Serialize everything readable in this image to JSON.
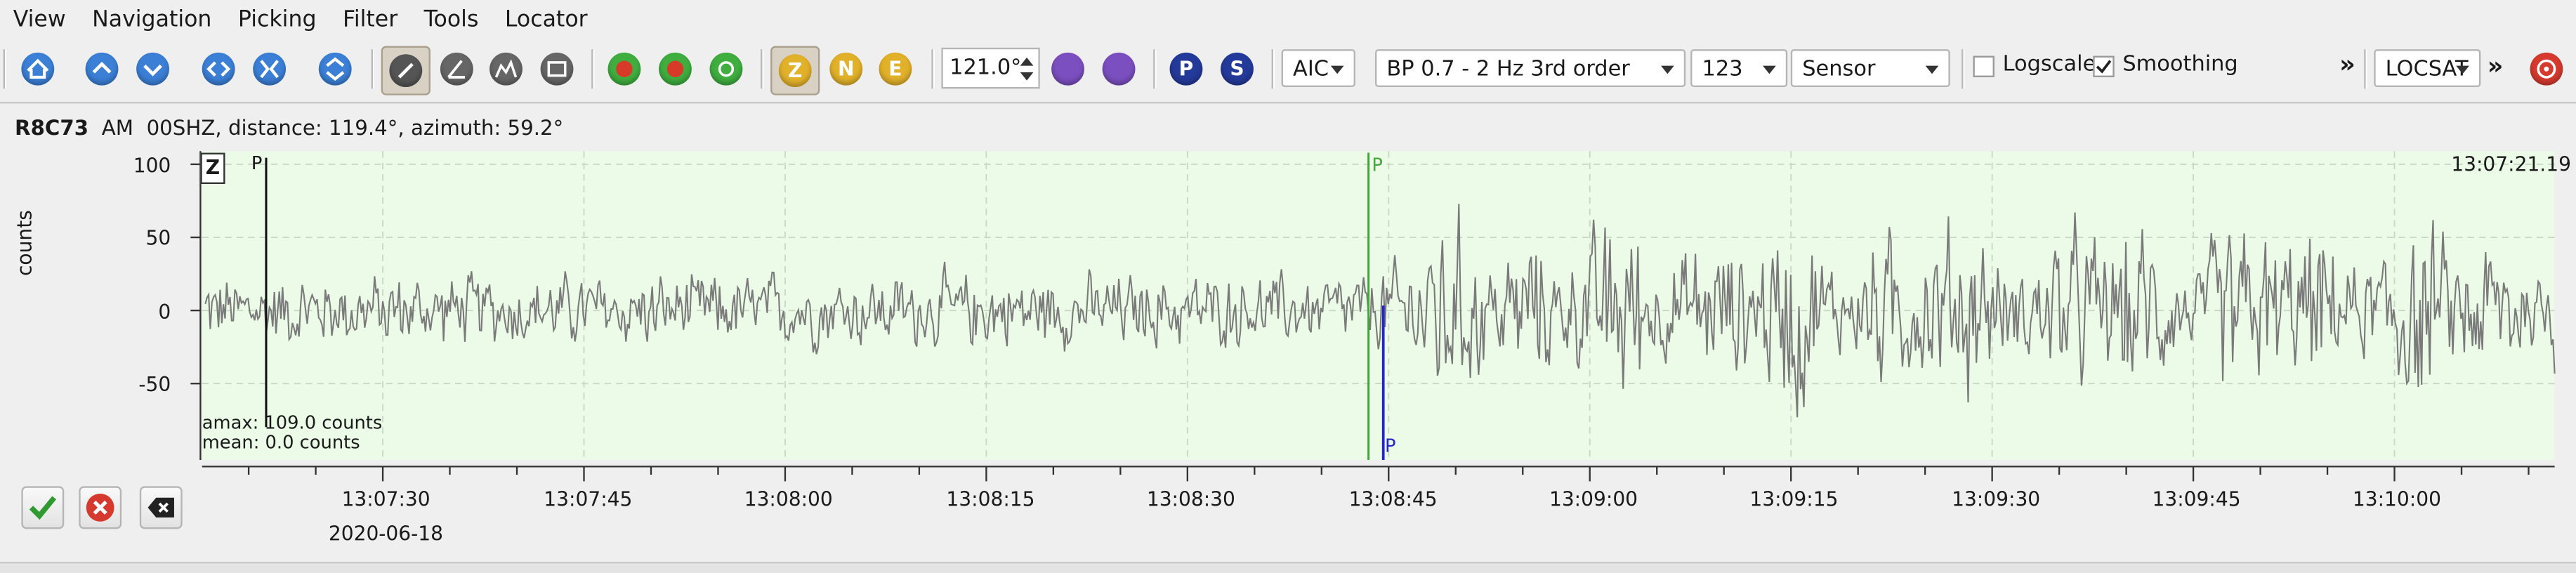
{
  "menu": [
    "View",
    "Navigation",
    "Picking",
    "Filter",
    "Tools",
    "Locator"
  ],
  "toolbar": {
    "angle_value": "121.0°",
    "picker_combo": "AIC",
    "filter_combo": "BP 0.7 - 2 Hz  3rd order",
    "component_combo": "123",
    "unit_combo": "Sensor",
    "logscale_label": "Logscale",
    "logscale_checked": false,
    "smoothing_label": "Smoothing",
    "smoothing_checked": true,
    "overflow_glyph": "»",
    "locator_combo": "LOCSAT",
    "component_buttons": [
      "Z",
      "N",
      "E"
    ],
    "pick_buttons": [
      "P",
      "S"
    ]
  },
  "station": {
    "code": "R8C73",
    "network": "AM",
    "channel": "00SHZ",
    "info": "distance: 119.4°, azimuth: 59.2°"
  },
  "trace": {
    "component": "Z",
    "time_right": "13:07:21.19",
    "ylabel": "counts",
    "yticks": [
      "100",
      "50",
      "0",
      "-50"
    ],
    "xticks": [
      "13:07:30",
      "13:07:45",
      "13:08:00",
      "13:08:15",
      "13:08:30",
      "13:08:45",
      "13:09:00",
      "13:09:15",
      "13:09:30",
      "13:09:45",
      "13:10:00"
    ],
    "date": "2020-06-18",
    "amax": "amax: 109.0 counts",
    "mean": "mean: 0.0 counts",
    "picks": {
      "theoretical_p": "P",
      "predicted_p": "P",
      "manual_p": "P"
    },
    "colors": {
      "trace": "#7a7a7a",
      "background": "#ecfbe7",
      "predicted": "#43a83c",
      "manual": "#2424c8",
      "theoretical": "#111111"
    }
  }
}
